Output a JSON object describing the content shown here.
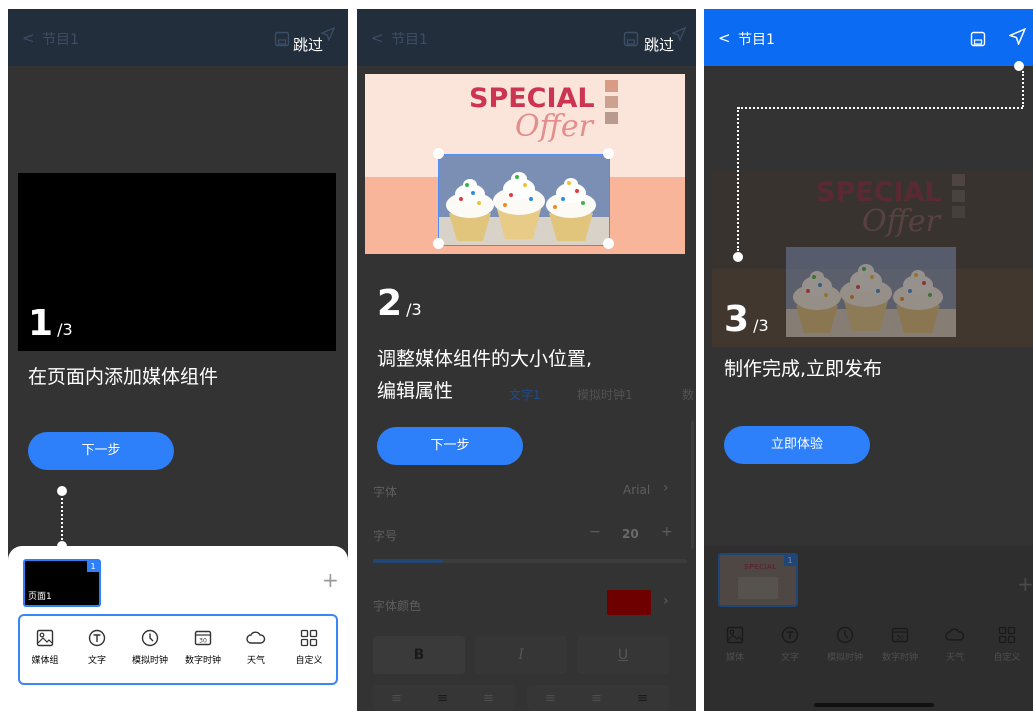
{
  "colors": {
    "accent": "#2e7ffa",
    "background": "#333333",
    "red_swatch": "#c00000"
  },
  "panel1": {
    "nav": {
      "back": "<",
      "title": "节目1",
      "skip": "跳过",
      "save_icon": "save-icon",
      "send_icon": "send-icon"
    },
    "step": {
      "current": "1",
      "total": "/3"
    },
    "instruction": "在页面内添加媒体组件",
    "next_button": "下一步",
    "page_thumbnail": {
      "label": "页面1",
      "badge": "1"
    },
    "add_page": "+",
    "tools": [
      {
        "label": "媒体组",
        "icon": "image-icon"
      },
      {
        "label": "文字",
        "icon": "text-icon"
      },
      {
        "label": "模拟时钟",
        "icon": "clock-icon"
      },
      {
        "label": "数字时钟",
        "icon": "digital-clock-icon"
      },
      {
        "label": "天气",
        "icon": "weather-icon"
      },
      {
        "label": "自定义",
        "icon": "grid-icon"
      }
    ]
  },
  "panel2": {
    "nav": {
      "back": "<",
      "title": "节目1",
      "skip": "跳过"
    },
    "promo": {
      "line1": "SPECIAL",
      "line2": "Offer"
    },
    "step": {
      "current": "2",
      "total": "/3"
    },
    "instruction_line1": "调整媒体组件的大小位置,",
    "instruction_line2": "编辑属性",
    "tabs": [
      "文字1",
      "模拟时钟1",
      "数"
    ],
    "next_button": "下一步",
    "properties": {
      "font_label": "字体",
      "font_value": "Arial",
      "size_label": "字号",
      "size_value": "20",
      "minus": "−",
      "plus": "+",
      "color_label": "字体颜色",
      "bold": "B",
      "italic": "I",
      "underline": "U"
    }
  },
  "panel3": {
    "nav": {
      "back": "<",
      "title": "节目1",
      "save_icon": "save-icon",
      "send_icon": "send-icon"
    },
    "promo": {
      "line1": "SPECIAL",
      "line2": "Offer"
    },
    "step": {
      "current": "3",
      "total": "/3"
    },
    "instruction": "制作完成,立即发布",
    "try_button": "立即体验",
    "thumbnail": {
      "line1": "SPECIAL",
      "badge": "1"
    },
    "add_page": "+",
    "tools": [
      {
        "label": "媒体",
        "icon": "image-icon"
      },
      {
        "label": "文字",
        "icon": "text-icon"
      },
      {
        "label": "模拟时钟",
        "icon": "clock-icon"
      },
      {
        "label": "数字时钟",
        "icon": "digital-clock-icon"
      },
      {
        "label": "天气",
        "icon": "weather-icon"
      },
      {
        "label": "自定义",
        "icon": "grid-icon"
      }
    ]
  }
}
